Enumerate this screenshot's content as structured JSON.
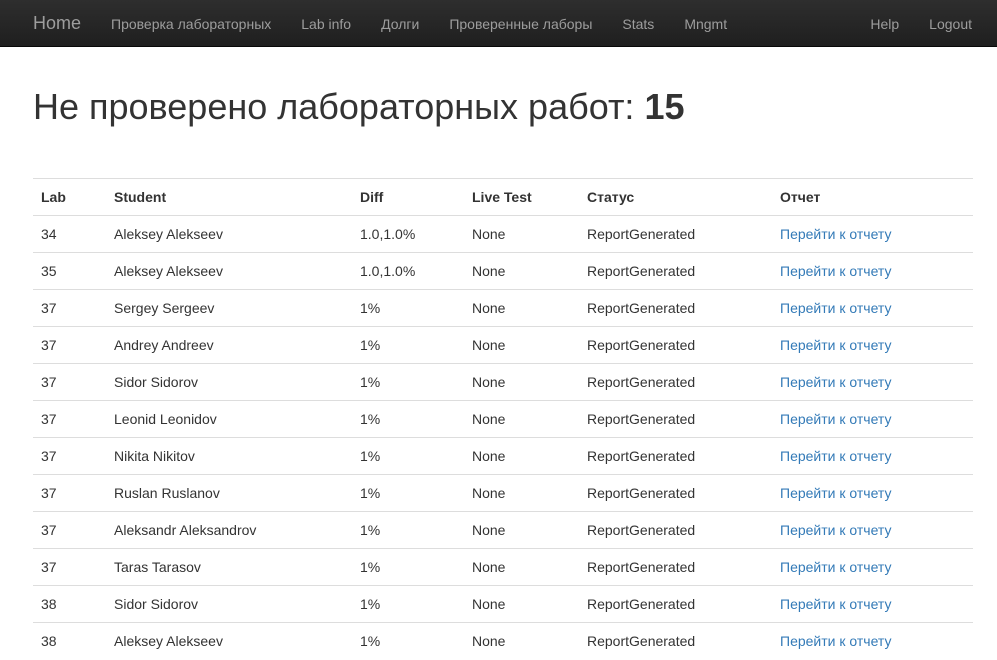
{
  "navbar": {
    "brand": "Home",
    "left_links": [
      "Проверка лабораторных",
      "Lab info",
      "Долги",
      "Проверенные лаборы",
      "Stats",
      "Mngmt"
    ],
    "right_links": [
      "Help",
      "Logout"
    ]
  },
  "page": {
    "title_prefix": "Не проверено лабораторных работ:",
    "count": "15"
  },
  "table": {
    "headers": [
      "Lab",
      "Student",
      "Diff",
      "Live Test",
      "Статус",
      "Отчет"
    ],
    "rows": [
      {
        "lab": "34",
        "student": "Aleksey Alekseev",
        "diff": "1.0,1.0%",
        "live": "None",
        "status": "ReportGenerated",
        "report": "Перейти к отчету"
      },
      {
        "lab": "35",
        "student": "Aleksey Alekseev",
        "diff": "1.0,1.0%",
        "live": "None",
        "status": "ReportGenerated",
        "report": "Перейти к отчету"
      },
      {
        "lab": "37",
        "student": "Sergey Sergeev",
        "diff": "1%",
        "live": "None",
        "status": "ReportGenerated",
        "report": "Перейти к отчету"
      },
      {
        "lab": "37",
        "student": "Andrey Andreev",
        "diff": "1%",
        "live": "None",
        "status": "ReportGenerated",
        "report": "Перейти к отчету"
      },
      {
        "lab": "37",
        "student": "Sidor Sidorov",
        "diff": "1%",
        "live": "None",
        "status": "ReportGenerated",
        "report": "Перейти к отчету"
      },
      {
        "lab": "37",
        "student": "Leonid Leonidov",
        "diff": "1%",
        "live": "None",
        "status": "ReportGenerated",
        "report": "Перейти к отчету"
      },
      {
        "lab": "37",
        "student": "Nikita Nikitov",
        "diff": "1%",
        "live": "None",
        "status": "ReportGenerated",
        "report": "Перейти к отчету"
      },
      {
        "lab": "37",
        "student": "Ruslan Ruslanov",
        "diff": "1%",
        "live": "None",
        "status": "ReportGenerated",
        "report": "Перейти к отчету"
      },
      {
        "lab": "37",
        "student": "Aleksandr Aleksandrov",
        "diff": "1%",
        "live": "None",
        "status": "ReportGenerated",
        "report": "Перейти к отчету"
      },
      {
        "lab": "37",
        "student": "Taras Tarasov",
        "diff": "1%",
        "live": "None",
        "status": "ReportGenerated",
        "report": "Перейти к отчету"
      },
      {
        "lab": "38",
        "student": "Sidor Sidorov",
        "diff": "1%",
        "live": "None",
        "status": "ReportGenerated",
        "report": "Перейти к отчету"
      },
      {
        "lab": "38",
        "student": "Aleksey Alekseev",
        "diff": "1%",
        "live": "None",
        "status": "ReportGenerated",
        "report": "Перейти к отчету"
      }
    ]
  }
}
